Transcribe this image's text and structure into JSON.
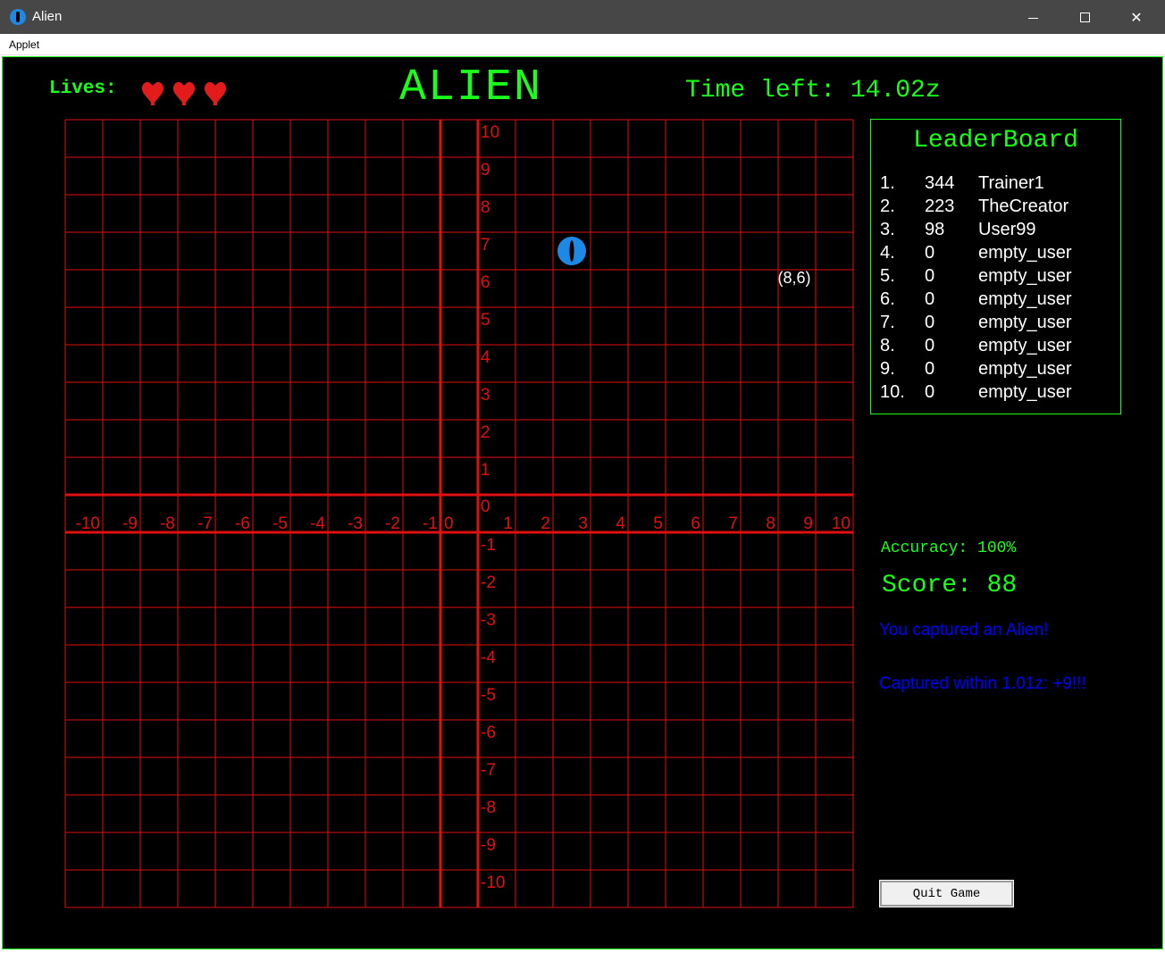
{
  "window": {
    "title": "Alien",
    "minimize": "—",
    "close": "✕"
  },
  "menu": {
    "items": [
      "Applet"
    ]
  },
  "header": {
    "lives_label": "Lives:",
    "lives_count": 3,
    "game_title": "ALIEN",
    "time_text": "Time left: 14.02z"
  },
  "grid": {
    "x_range": [
      -10,
      10
    ],
    "y_range": [
      -10,
      10
    ],
    "x_tick_labels": [
      "-10",
      "-9",
      "-8",
      "-7",
      "-6",
      "-5",
      "-4",
      "-3",
      "-2",
      "-1",
      "0",
      "1",
      "2",
      "3",
      "4",
      "5",
      "6",
      "7",
      "8",
      "9",
      "10"
    ],
    "y_tick_labels_positive": [
      "10",
      "9",
      "8",
      "7",
      "6",
      "5",
      "4",
      "3",
      "2",
      "1",
      "0"
    ],
    "y_tick_labels_negative": [
      "-1",
      "-2",
      "-3",
      "-4",
      "-5",
      "-6",
      "-7",
      "-8",
      "-9",
      "-10"
    ],
    "line_color": "#e01010",
    "alien": {
      "x": 2.5,
      "y": 6.5,
      "color": "#1e88e5"
    },
    "cursor_label": {
      "text": "(8,6)",
      "x": 8,
      "y": 6
    }
  },
  "leaderboard": {
    "title": "LeaderBoard",
    "rows": [
      {
        "rank": "1.",
        "score": "344",
        "name": "Trainer1"
      },
      {
        "rank": "2.",
        "score": "223",
        "name": "TheCreator"
      },
      {
        "rank": "3.",
        "score": "98",
        "name": "User99"
      },
      {
        "rank": "4.",
        "score": "0",
        "name": "empty_user"
      },
      {
        "rank": "5.",
        "score": "0",
        "name": "empty_user"
      },
      {
        "rank": "6.",
        "score": "0",
        "name": "empty_user"
      },
      {
        "rank": "7.",
        "score": "0",
        "name": "empty_user"
      },
      {
        "rank": "8.",
        "score": "0",
        "name": "empty_user"
      },
      {
        "rank": "9.",
        "score": "0",
        "name": "empty_user"
      },
      {
        "rank": "10.",
        "score": "0",
        "name": "empty_user"
      }
    ]
  },
  "stats": {
    "accuracy": "Accuracy: 100%",
    "score": "Score: 88"
  },
  "messages": {
    "capture": "You captured an Alien!",
    "bonus": "Captured within 1.01z: +9!!!"
  },
  "quit_label": "Quit Game",
  "colors": {
    "accent_green": "#19ff19",
    "grid_red": "#e01010",
    "message_blue": "#0000ff",
    "heart_red": "#e41b1b"
  }
}
